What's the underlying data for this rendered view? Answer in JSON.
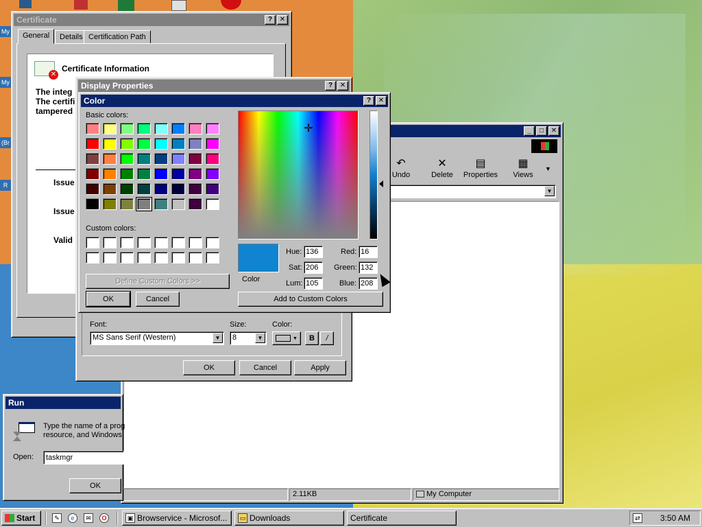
{
  "certificate": {
    "title": "Certificate",
    "tabs": [
      "General",
      "Details",
      "Certification Path"
    ],
    "info_heading": "Certificate Information",
    "text_lines": [
      "The integ",
      "The certifi",
      "tampered"
    ],
    "fields": [
      "Issue",
      "Issue",
      "Valid"
    ]
  },
  "explorer": {
    "toolbar": [
      "Undo",
      "Delete",
      "Properties",
      "Views"
    ],
    "status": {
      "size": "2.11KB",
      "zone": "My Computer"
    }
  },
  "display": {
    "title": "Display Properties",
    "font_label": "Font:",
    "font_value": "MS Sans Serif (Western)",
    "size_label": "Size:",
    "size_value": "8",
    "color_label": "Color:",
    "bold_label": "B",
    "italic_label": "/",
    "ok": "OK",
    "cancel": "Cancel",
    "apply": "Apply"
  },
  "color_dialog": {
    "title": "Color",
    "basic_label": "Basic colors:",
    "custom_label": "Custom colors:",
    "basic_colors": [
      "#ff8080",
      "#ffff80",
      "#80ff80",
      "#00ff80",
      "#80ffff",
      "#0080ff",
      "#ff80c0",
      "#ff80ff",
      "#ff0000",
      "#ffff00",
      "#80ff00",
      "#00ff40",
      "#00ffff",
      "#0080c0",
      "#8080c0",
      "#ff00ff",
      "#804040",
      "#ff8040",
      "#00ff00",
      "#008080",
      "#004080",
      "#8080ff",
      "#800040",
      "#ff0080",
      "#800000",
      "#ff8000",
      "#008000",
      "#008040",
      "#0000ff",
      "#0000a0",
      "#800080",
      "#8000ff",
      "#400000",
      "#804000",
      "#004000",
      "#004040",
      "#000080",
      "#000040",
      "#400040",
      "#400080",
      "#000000",
      "#808000",
      "#808040",
      "#808080",
      "#408080",
      "#c0c0c0",
      "#400040",
      "#ffffff"
    ],
    "selected_index": 43,
    "define_custom": "Define Custom Colors >>",
    "ok": "OK",
    "cancel": "Cancel",
    "add_custom": "Add to Custom Colors",
    "preview_label": "Color",
    "current_color": "#1084d0",
    "hue_label": "Hue:",
    "hue": "136",
    "sat_label": "Sat:",
    "sat": "206",
    "lum_label": "Lum:",
    "lum": "105",
    "red_label": "Red:",
    "red": "16",
    "green_label": "Green:",
    "green": "132",
    "blue_label": "Blue:",
    "blue": "208"
  },
  "run": {
    "title": "Run",
    "description_1": "Type the name of a prog",
    "description_2": "resource, and Windows",
    "open_label": "Open:",
    "open_value": "taskmgr",
    "ok": "OK"
  },
  "taskbar": {
    "start": "Start",
    "tasks": [
      "Browservice - Microsof...",
      "Downloads",
      "Certificate"
    ],
    "clock": "3:50 AM"
  },
  "desktop": {
    "side_labels": [
      "My",
      "My",
      "(Br",
      "R"
    ]
  }
}
